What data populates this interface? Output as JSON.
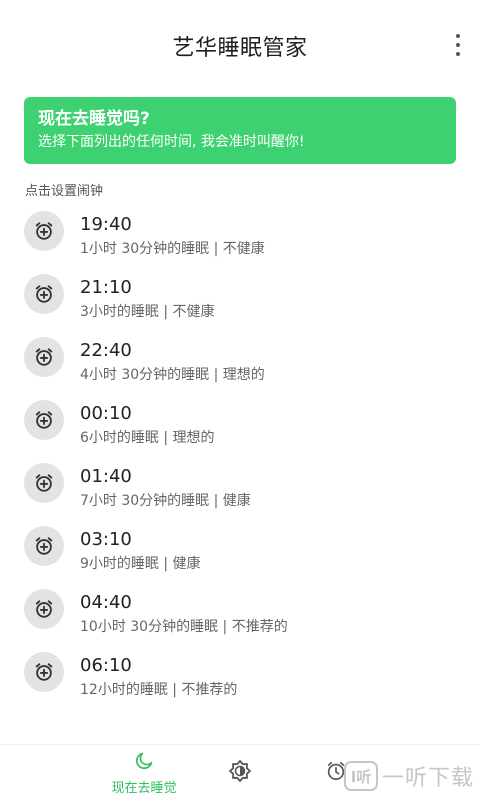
{
  "app": {
    "title": "艺华睡眠管家"
  },
  "banner": {
    "title": "现在去睡觉吗?",
    "subtitle": "选择下面列出的任何时间, 我会准时叫醒你!"
  },
  "section_label": "点击设置闹钟",
  "alarms": [
    {
      "time": "19:40",
      "desc": "1小时 30分钟的睡眠 | 不健康"
    },
    {
      "time": "21:10",
      "desc": "3小时的睡眠 | 不健康"
    },
    {
      "time": "22:40",
      "desc": "4小时 30分钟的睡眠 | 理想的"
    },
    {
      "time": "00:10",
      "desc": "6小时的睡眠 | 理想的"
    },
    {
      "time": "01:40",
      "desc": "7小时 30分钟的睡眠 | 健康"
    },
    {
      "time": "03:10",
      "desc": "9小时的睡眠 | 健康"
    },
    {
      "time": "04:40",
      "desc": "10小时 30分钟的睡眠 | 不推荐的"
    },
    {
      "time": "06:10",
      "desc": "12小时的睡眠 | 不推荐的"
    }
  ],
  "nav": {
    "sleep_label": "现在去睡觉",
    "sleep_icon": "moon-icon",
    "wake_icon": "brightness-icon",
    "history_icon": "alarm-clock-icon"
  },
  "watermark": {
    "logo_text": "I听",
    "text": "一听下载"
  },
  "colors": {
    "accent": "#3dd171",
    "nav_active": "#2fbf5f"
  }
}
